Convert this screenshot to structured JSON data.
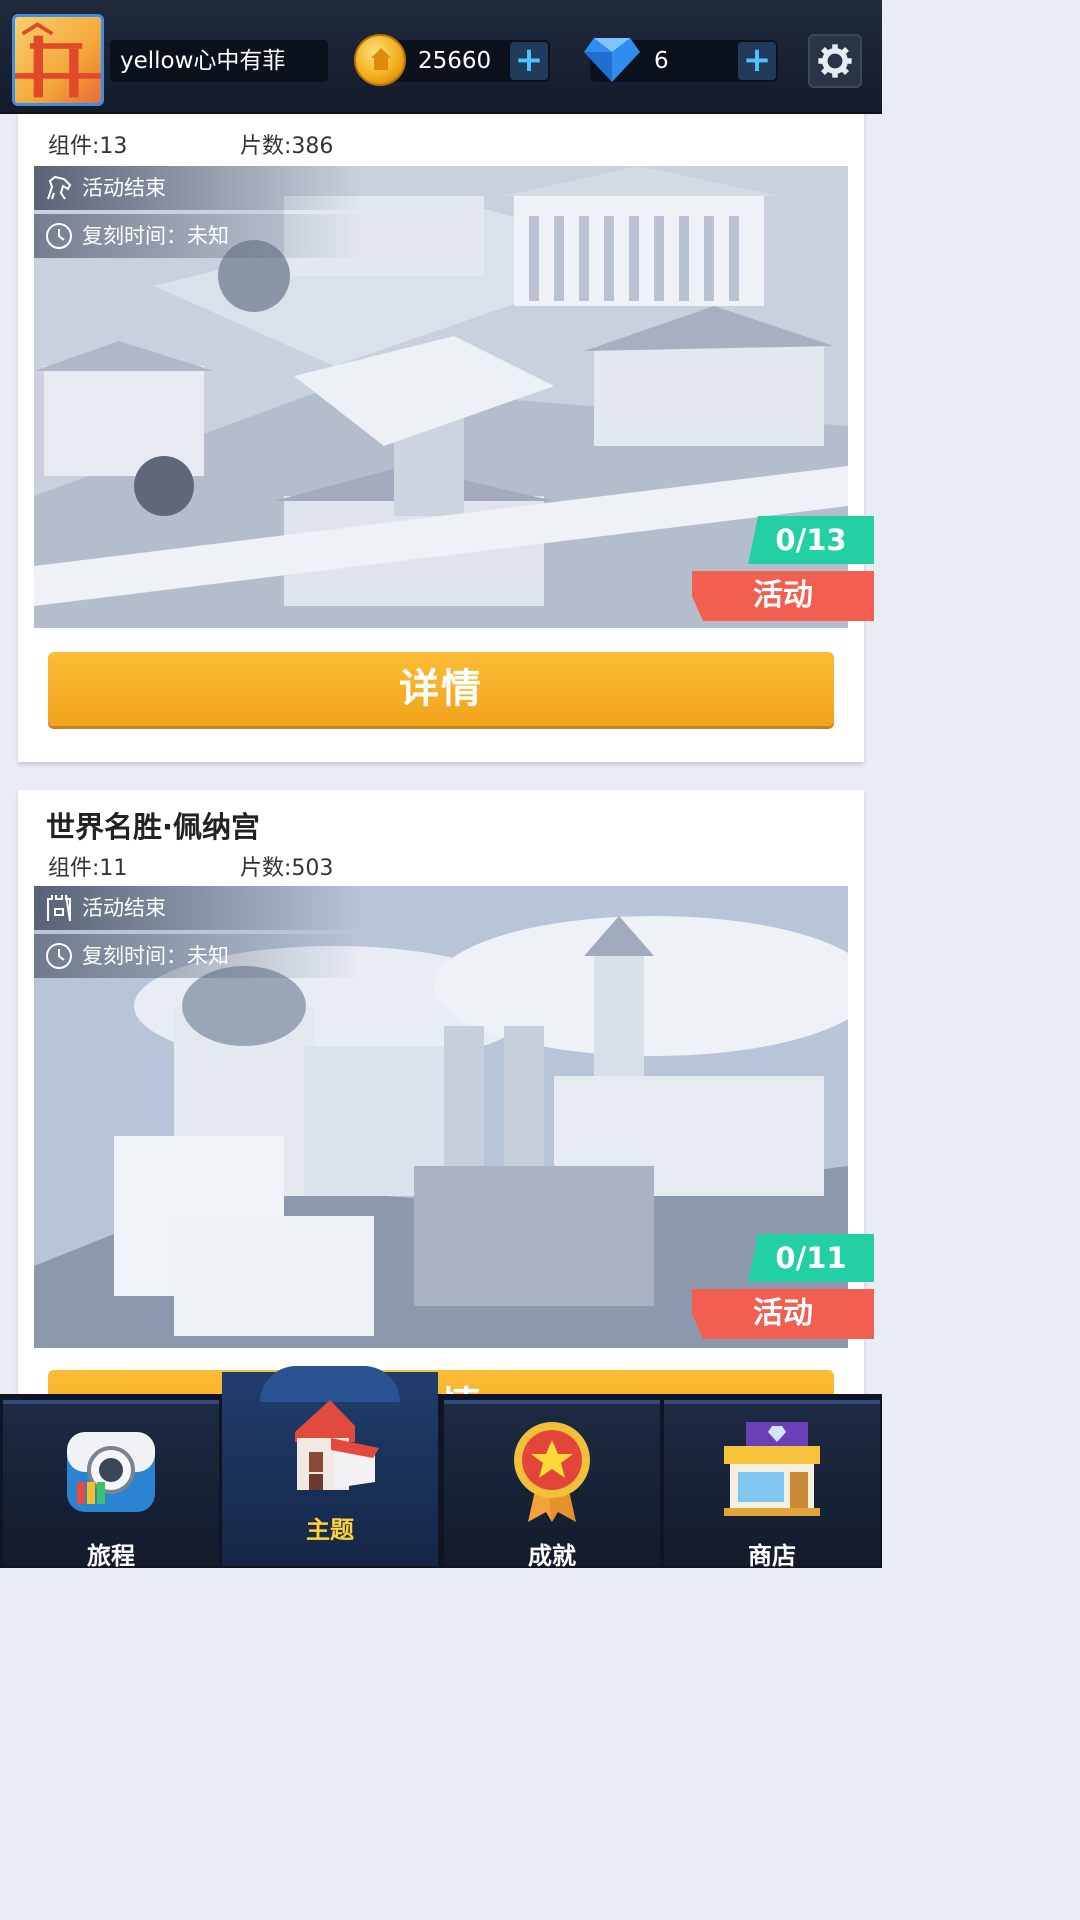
{
  "header": {
    "username": "yellow心中有菲",
    "coins": "25660",
    "gems": "6",
    "plus_label": "+"
  },
  "themes": [
    {
      "title": "",
      "components_label": "组件:13",
      "pieces_label": "片数:386",
      "status": "活动结束",
      "reprint": "复刻时间：未知",
      "progress": "0/13",
      "tag": "活动",
      "detail_label": "详情"
    },
    {
      "title": "世界名胜·佩纳宫",
      "components_label": "组件:11",
      "pieces_label": "片数:503",
      "status": "活动结束",
      "reprint": "复刻时间：未知",
      "progress": "0/11",
      "tag": "活动",
      "detail_label": "详情"
    }
  ],
  "nav": [
    {
      "label": "旅程",
      "icon": "camera-icon"
    },
    {
      "label": "主题",
      "icon": "house-icon",
      "active": true
    },
    {
      "label": "成就",
      "icon": "medal-icon"
    },
    {
      "label": "商店",
      "icon": "shop-icon"
    }
  ]
}
